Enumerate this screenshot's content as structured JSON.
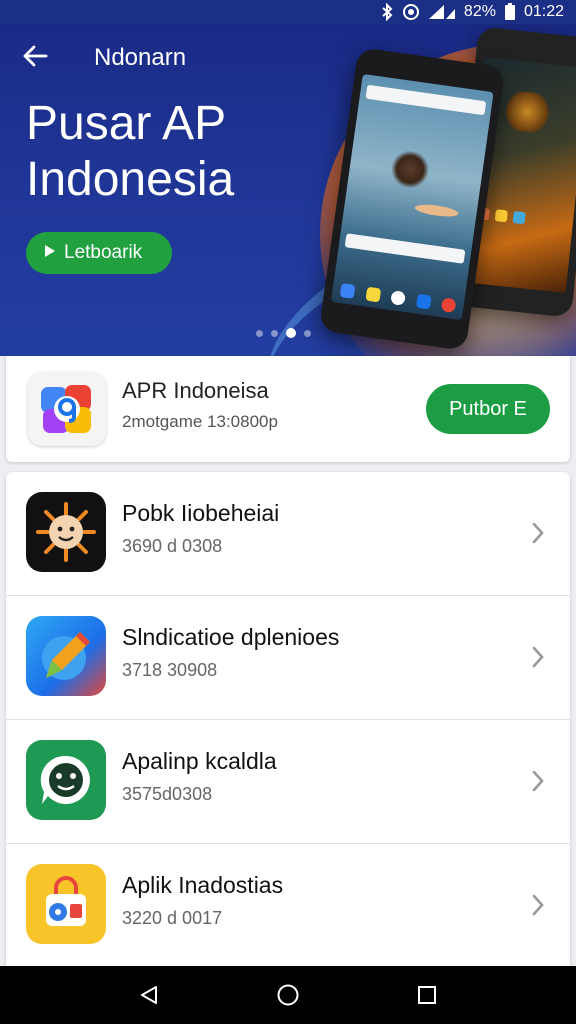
{
  "status_bar": {
    "battery": "82%",
    "time": "01:22",
    "icons": [
      "bluetooth-icon",
      "eye-icon",
      "wifi-signal-icon",
      "battery-icon"
    ]
  },
  "app_bar": {
    "title": "Ndonarn",
    "back_icon": "arrow-left-icon"
  },
  "hero": {
    "title_line1": "Pusar AP",
    "title_line2": "Indonesia",
    "cta_label": "Letboarik",
    "cta_icon": "play-icon",
    "slides": 4,
    "active_slide": 3
  },
  "featured": {
    "name": "APR Indoneisa",
    "subtitle": "2motgame 13:0800p",
    "button_label": "Putbor E",
    "icon": "colorful-app-icon"
  },
  "apps": [
    {
      "title": "Pobk Iiobeheiai",
      "subtitle": "3690 d 0308",
      "icon": "sun-face-icon"
    },
    {
      "title": "Slndicatioe dplenioes",
      "subtitle": "3718 30908",
      "icon": "pencil-app-icon"
    },
    {
      "title": "Apalinp kcaldla",
      "subtitle": "3575d0308",
      "icon": "chat-bubble-icon"
    },
    {
      "title": "Aplik Inadostias",
      "subtitle": "3220 d 0017",
      "icon": "shopping-bag-icon"
    }
  ],
  "colors": {
    "primary": "#1f3596",
    "accent_green": "#1c9d43",
    "hero_orange": "#ec6c1c"
  },
  "nav": [
    "back-triangle-icon",
    "home-circle-icon",
    "recents-square-icon"
  ]
}
